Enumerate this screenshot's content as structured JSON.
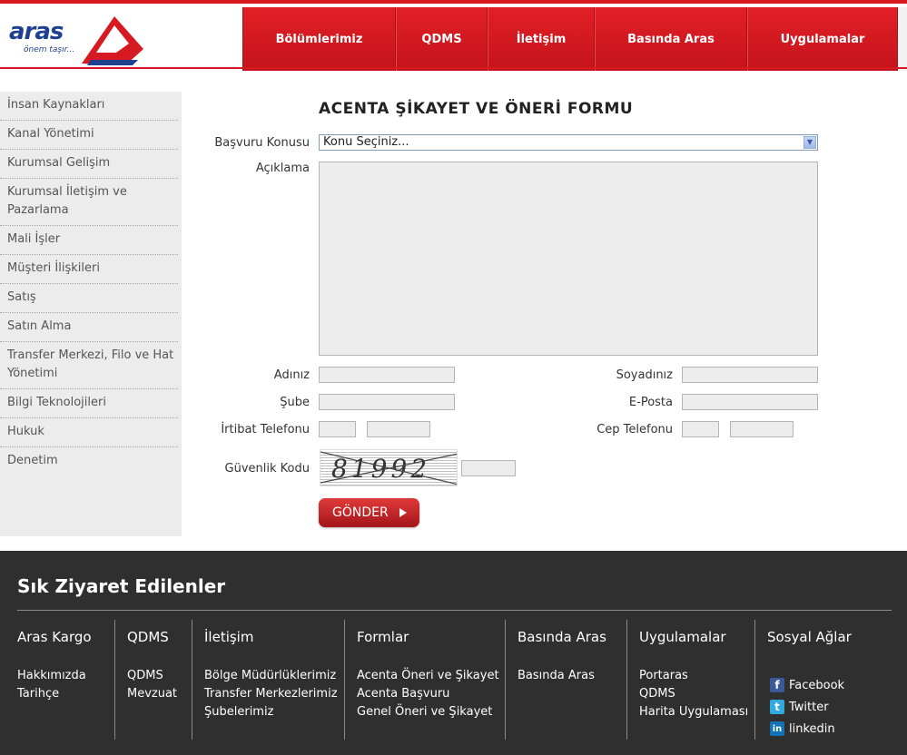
{
  "logo": {
    "brand": "aras",
    "tagline": "önem taşır..."
  },
  "nav": {
    "items": [
      {
        "label": "Bölümlerimiz"
      },
      {
        "label": "QDMS"
      },
      {
        "label": "İletişim"
      },
      {
        "label": "Basında Aras"
      },
      {
        "label": "Uygulamalar"
      }
    ]
  },
  "sidebar": {
    "items": [
      {
        "label": "İnsan Kaynakları"
      },
      {
        "label": "Kanal Yönetimi"
      },
      {
        "label": "Kurumsal Gelişim"
      },
      {
        "label": "Kurumsal İletişim ve Pazarlama"
      },
      {
        "label": "Mali İşler"
      },
      {
        "label": "Müşteri İlişkileri"
      },
      {
        "label": "Satış"
      },
      {
        "label": "Satın Alma"
      },
      {
        "label": "Transfer Merkezi, Filo ve Hat Yönetimi"
      },
      {
        "label": "Bilgi Teknolojileri"
      },
      {
        "label": "Hukuk"
      },
      {
        "label": "Denetim"
      }
    ]
  },
  "form": {
    "title": "ACENTA ŞİKAYET VE ÖNERİ FORMU",
    "subject_label": "Başvuru Konusu",
    "subject_value": "Konu Seçiniz...",
    "description_label": "Açıklama",
    "name_label": "Adınız",
    "surname_label": "Soyadınız",
    "branch_label": "Şube",
    "email_label": "E-Posta",
    "phone_label": "İrtibat Telefonu",
    "mobile_label": "Cep Telefonu",
    "captcha_label": "Güvenlik Kodu",
    "captcha_text": "81992 2",
    "submit_label": "GÖNDER"
  },
  "footer": {
    "title": "Sık Ziyaret Edilenler",
    "columns": [
      {
        "heading": "Aras Kargo",
        "links": [
          "Hakkımızda",
          "Tarihçe"
        ]
      },
      {
        "heading": "QDMS",
        "links": [
          "QDMS",
          "Mevzuat"
        ]
      },
      {
        "heading": "İletişim",
        "links": [
          "Bölge Müdürlüklerimiz",
          "Transfer Merkezlerimiz",
          "Şubelerimiz"
        ]
      },
      {
        "heading": "Formlar",
        "links": [
          "Acenta Öneri ve Şikayet",
          "Acenta Başvuru",
          "Genel Öneri ve Şikayet"
        ]
      },
      {
        "heading": "Basında Aras",
        "links": [
          "Basında Aras"
        ]
      },
      {
        "heading": "Uygulamalar",
        "links": [
          "Portaras",
          "QDMS",
          "Harita Uygulaması"
        ]
      },
      {
        "heading": "Sosyal Ağlar",
        "links": [
          "Facebook",
          "Twitter",
          "linkedin"
        ]
      }
    ]
  },
  "colors": {
    "brand_red": "#d71921",
    "brand_blue": "#1f3f8f",
    "footer_bg": "#2f2f2f",
    "sidebar_bg": "#ececec"
  },
  "icons": {
    "facebook": "facebook-icon",
    "twitter": "twitter-icon",
    "linkedin": "linkedin-icon",
    "select_arrow": "chevron-down-icon",
    "submit_arrow": "play-arrow-icon"
  }
}
